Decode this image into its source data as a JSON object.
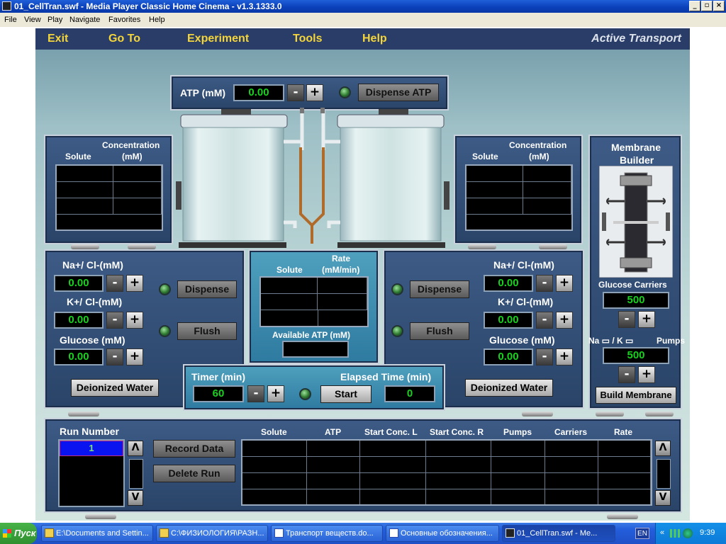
{
  "window": {
    "title": "01_CellTran.swf - Media Player Classic Home Cinema - v1.3.1333.0",
    "min": "_",
    "max": "▫",
    "close": "×"
  },
  "menubar": [
    "File",
    "View",
    "Play",
    "Navigate",
    "Favorites",
    "Help"
  ],
  "app": {
    "nav": [
      "Exit",
      "Go To",
      "Experiment",
      "Tools",
      "Help"
    ],
    "title": "Active Transport"
  },
  "atp": {
    "label": "ATP (mM)",
    "value": "0.00",
    "minus": "-",
    "plus": "+",
    "dispense_label": "Dispense ATP"
  },
  "beaker_left": {
    "solute_header": "Solute",
    "conc_header": "Concentration",
    "conc_unit": "(mM)"
  },
  "beaker_right": {
    "solute_header": "Solute",
    "conc_header": "Concentration",
    "conc_unit": "(mM)"
  },
  "left_controls": {
    "na_label": "Na+/ Cl-(mM)",
    "na_value": "0.00",
    "k_label": "K+/ Cl-(mM)",
    "k_value": "0.00",
    "glucose_label": "Glucose (mM)",
    "glucose_value": "0.00",
    "dispense": "Dispense",
    "flush": "Flush",
    "deionized": "Deionized Water",
    "minus": "-",
    "plus": "+"
  },
  "right_controls": {
    "na_label": "Na+/ Cl-(mM)",
    "na_value": "0.00",
    "k_label": "K+/ Cl-(mM)",
    "k_value": "0.00",
    "glucose_label": "Glucose (mM)",
    "glucose_value": "0.00",
    "dispense": "Dispense",
    "flush": "Flush",
    "deionized": "Deionized Water",
    "minus": "-",
    "plus": "+"
  },
  "rate_panel": {
    "solute_header": "Solute",
    "rate_header": "Rate",
    "rate_unit": "(mM/min)",
    "available_atp_label": "Available ATP (mM)",
    "available_atp_value": ""
  },
  "timer": {
    "label": "Timer (min)",
    "value": "60",
    "elapsed_label": "Elapsed Time (min)",
    "elapsed_value": "0",
    "start": "Start",
    "minus": "-",
    "plus": "+"
  },
  "membrane": {
    "title1": "Membrane",
    "title2": "Builder",
    "glucose_label": "Glucose Carriers",
    "glucose_value": "500",
    "na_k_label": "Na ▭ / K ▭",
    "pumps_label": "Pumps",
    "pumps_value": "500",
    "build": "Build Membrane",
    "minus": "-",
    "plus": "+"
  },
  "runs": {
    "run_number_label": "Run Number",
    "current_run": "1",
    "record": "Record Data",
    "delete": "Delete Run",
    "up": "Λ",
    "down": "V",
    "columns": [
      "Solute",
      "ATP",
      "Start Conc. L",
      "Start Conc. R",
      "Pumps",
      "Carriers",
      "Rate"
    ]
  },
  "taskbar": {
    "start": "Пуск",
    "tasks": [
      "E:\\Documents and Settin...",
      "C:\\ФИЗИОЛОГИЯ\\РАЗН...",
      "Транспорт веществ.do...",
      "Основные обозначения...",
      "01_CellTran.swf - Me..."
    ],
    "lang": "EN",
    "time": "9:39"
  }
}
